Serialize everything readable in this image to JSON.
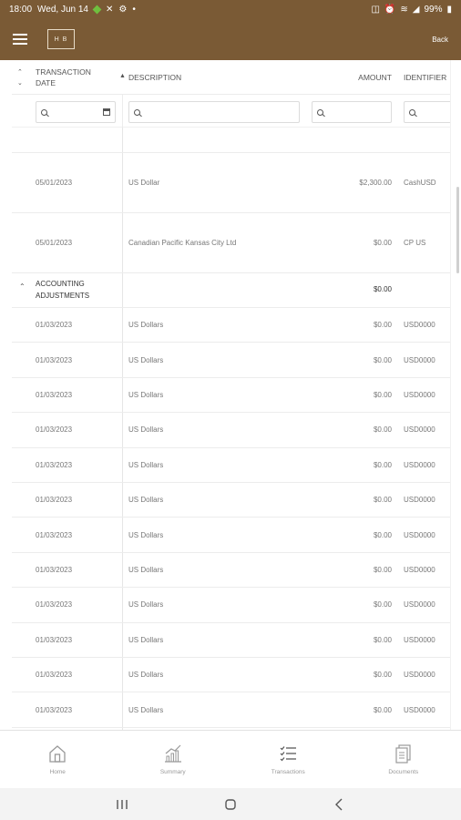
{
  "status_bar": {
    "time": "18:00",
    "date": "Wed, Jun 14",
    "battery": "99%"
  },
  "app_bar": {
    "logo_text": "H B",
    "back_label": "Back"
  },
  "table": {
    "columns": {
      "date": "TRANSACTION DATE",
      "description": "DESCRIPTION",
      "amount": "AMOUNT",
      "identifier": "IDENTIFIER"
    },
    "rows_top": [
      {
        "date": "05/01/2023",
        "description": "US Dollar",
        "amount": "$2,300.00",
        "identifier": "CashUSD"
      },
      {
        "date": "05/01/2023",
        "description": "Canadian Pacific Kansas City Ltd",
        "amount": "$0.00",
        "identifier": "CP US"
      }
    ],
    "group": {
      "label": "ACCOUNTING ADJUSTMENTS",
      "amount": "$0.00"
    },
    "group_rows": [
      {
        "date": "01/03/2023",
        "description": "US Dollars",
        "amount": "$0.00",
        "identifier": "USD0000"
      },
      {
        "date": "01/03/2023",
        "description": "US Dollars",
        "amount": "$0.00",
        "identifier": "USD0000"
      },
      {
        "date": "01/03/2023",
        "description": "US Dollars",
        "amount": "$0.00",
        "identifier": "USD0000"
      },
      {
        "date": "01/03/2023",
        "description": "US Dollars",
        "amount": "$0.00",
        "identifier": "USD0000"
      },
      {
        "date": "01/03/2023",
        "description": "US Dollars",
        "amount": "$0.00",
        "identifier": "USD0000"
      },
      {
        "date": "01/03/2023",
        "description": "US Dollars",
        "amount": "$0.00",
        "identifier": "USD0000"
      },
      {
        "date": "01/03/2023",
        "description": "US Dollars",
        "amount": "$0.00",
        "identifier": "USD0000"
      },
      {
        "date": "01/03/2023",
        "description": "US Dollars",
        "amount": "$0.00",
        "identifier": "USD0000"
      },
      {
        "date": "01/03/2023",
        "description": "US Dollars",
        "amount": "$0.00",
        "identifier": "USD0000"
      },
      {
        "date": "01/03/2023",
        "description": "US Dollars",
        "amount": "$0.00",
        "identifier": "USD0000"
      },
      {
        "date": "01/03/2023",
        "description": "US Dollars",
        "amount": "$0.00",
        "identifier": "USD0000"
      },
      {
        "date": "01/03/2023",
        "description": "US Dollars",
        "amount": "$0.00",
        "identifier": "USD0000"
      }
    ]
  },
  "bottom_nav": {
    "items": [
      {
        "label": "Home",
        "icon": "home-icon"
      },
      {
        "label": "Summary",
        "icon": "summary-chart-icon"
      },
      {
        "label": "Transactions",
        "icon": "transactions-list-icon"
      },
      {
        "label": "Documents",
        "icon": "documents-icon"
      }
    ]
  },
  "colors": {
    "brand": "#7a5a35"
  }
}
